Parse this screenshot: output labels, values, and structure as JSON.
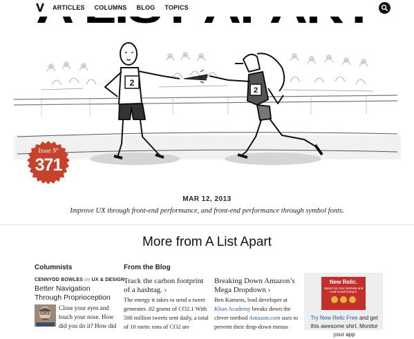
{
  "nav": {
    "items": [
      "ARTICLES",
      "COLUMNS",
      "BLOG",
      "TOPICS"
    ]
  },
  "masthead": "A LIST APART",
  "issue": {
    "label": "Issue Nº",
    "number": "371",
    "date": "MAR 12, 2013",
    "tagline": "Improve UX through front-end performance, and front-end performance through symbol fonts."
  },
  "illustration": {
    "runner_bib": "2",
    "robot_bib": "2"
  },
  "more": {
    "heading": "More from A List Apart"
  },
  "columnists": {
    "heading": "Columnists",
    "author": "CENNYDD BOWLES",
    "on": "on",
    "topic": "UX & DESIGN",
    "title": "Better Navigation Through Proprioception",
    "excerpt": "Close your eyes and touch your nose. How did you do it? How did"
  },
  "blog": {
    "heading": "From the Blog",
    "post1": {
      "title": "Track the carbon footprint of a hashtag.",
      "arrow": "›",
      "excerpt": "The energy it takes to send a tweet generates .02 grams of CO2.1 With 500 million tweets sent daily, a total of 10 metic tons of CO2 are"
    },
    "post2": {
      "title": "Breaking Down Amazon’s Mega Dropdown",
      "arrow": "›",
      "excerpt_start": "Ben Kamens, lead developer at",
      "link1": "Khan Academy",
      "excerpt_mid": "breaks down the clever method",
      "link2": "Amazon.com",
      "excerpt_end": "uses to prevent their drop-down menus"
    }
  },
  "ad": {
    "logo": "New Relic.",
    "subline": "Speed Up Your Website and Look Good Doing It.",
    "link": "Try New Relic Free",
    "text": "and get this awesome shirt. Monitor your app"
  },
  "colors": {
    "badge": "#c5432c",
    "link": "#2a5aa0",
    "ad_red": "#c32f2b"
  }
}
